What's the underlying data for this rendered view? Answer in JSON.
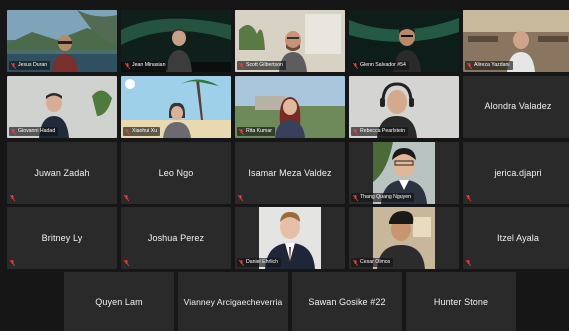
{
  "meeting": {
    "tiles": [
      {
        "name": "Jesus Duran"
      },
      {
        "name": "Jean Minasian"
      },
      {
        "name": "Scott Gilbertson"
      },
      {
        "name": "Glenn Salvador #54"
      },
      {
        "name": "Alireza Yazdani"
      },
      {
        "name": "Giovanni Hadad"
      },
      {
        "name": "Xiaohui Xu"
      },
      {
        "name": "Rita Kumar"
      },
      {
        "name": "Rebecca Pearlstein"
      },
      {
        "name": "Alondra Valadez"
      },
      {
        "name": "Juwan Zadah"
      },
      {
        "name": "Leo Ngo"
      },
      {
        "name": "Isamar Meza Valdez"
      },
      {
        "name": "Thang Quang Nguyen"
      },
      {
        "name": "jerica.djapri"
      },
      {
        "name": "Britney Ly"
      },
      {
        "name": "Joshua Perez"
      },
      {
        "name": "Daniel Ehrlich"
      },
      {
        "name": "Cesar Olmos"
      },
      {
        "name": "Itzel Ayala"
      },
      {
        "name": "Quyen Lam"
      },
      {
        "name": "Vianney Arcigaecheverria"
      },
      {
        "name": "Sawan Gosike #22"
      },
      {
        "name": "Hunter Stone"
      }
    ],
    "colors": {
      "active_speaker_border": "#d8d860",
      "muted_mic": "#e04040",
      "tile_background": "#2a2a2a"
    },
    "icons": {
      "muted": "muted-mic-icon"
    }
  }
}
